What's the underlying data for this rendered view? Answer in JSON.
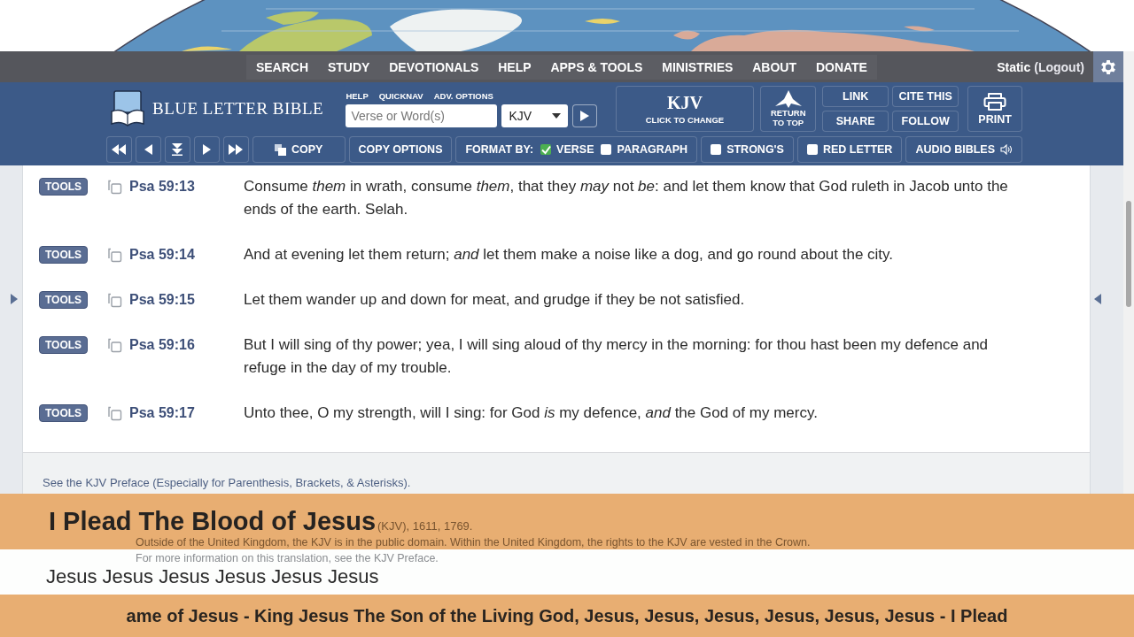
{
  "nav": {
    "items": [
      "SEARCH",
      "STUDY",
      "DEVOTIONALS",
      "HELP",
      "APPS & TOOLS",
      "MINISTRIES",
      "ABOUT",
      "DONATE"
    ],
    "user": "Static",
    "logout": "(Logout)"
  },
  "header": {
    "site_name": "BLUE LETTER BIBLE",
    "links": [
      "HELP",
      "QUICKNAV",
      "ADV. OPTIONS"
    ],
    "search": {
      "placeholder": "Verse or Word(s)"
    },
    "version": "KJV",
    "version_button": {
      "label": "KJV",
      "caption": "CLICK TO CHANGE"
    },
    "return_top": "RETURN TO TOP",
    "actions": [
      "LINK",
      "CITE THIS",
      "SHARE",
      "FOLLOW"
    ],
    "print": "PRINT"
  },
  "toolbar": {
    "copy": "COPY",
    "copy_options": "COPY OPTIONS",
    "format_label": "FORMAT BY:",
    "formats": [
      {
        "label": "VERSE",
        "checked": true
      },
      {
        "label": "PARAGRAPH",
        "checked": false
      }
    ],
    "toggles": [
      {
        "label": "STRONG'S",
        "checked": false
      },
      {
        "label": "RED LETTER",
        "checked": false
      }
    ],
    "audio": "AUDIO BIBLES"
  },
  "verses": [
    {
      "tools": "TOOLS",
      "ref": "Psa 59:13",
      "text": "Consume *them* in wrath, consume *them*, that they *may* not *be*: and let them know that God ruleth in Jacob unto the ends of the earth. Selah."
    },
    {
      "tools": "TOOLS",
      "ref": "Psa 59:14",
      "text": "And at evening let them return; *and* let them make a noise like a dog, and go round about the city."
    },
    {
      "tools": "TOOLS",
      "ref": "Psa 59:15",
      "text": "Let them wander up and down for meat, and grudge if they be not satisfied."
    },
    {
      "tools": "TOOLS",
      "ref": "Psa 59:16",
      "text": "But I will sing of thy power; yea, I will sing aloud of thy mercy in the morning: for thou hast been my defence and refuge in the day of my trouble."
    },
    {
      "tools": "TOOLS",
      "ref": "Psa 59:17",
      "text": "Unto thee, O my strength, will I sing: for God *is* my defence, *and* the God of my mercy."
    }
  ],
  "footer_note": "See the KJV Preface (Especially for Parenthesis, Brackets, & Asterisks).",
  "copyright": {
    "fragment": "(KJV), 1611, 1769.",
    "lines": [
      "Outside of the United Kingdom, the KJV is in the public domain. Within the United Kingdom, the rights to the KJV are vested in the Crown.",
      "For more information on this translation, see the KJV Preface."
    ]
  },
  "overlay": {
    "title": "I Plead The Blood of Jesus",
    "subtitle": "Jesus Jesus Jesus Jesus Jesus Jesus",
    "ticker": "ame of Jesus - King Jesus The Son of the Living God, Jesus, Jesus, Jesus, Jesus, Jesus, Jesus - I Plead"
  }
}
